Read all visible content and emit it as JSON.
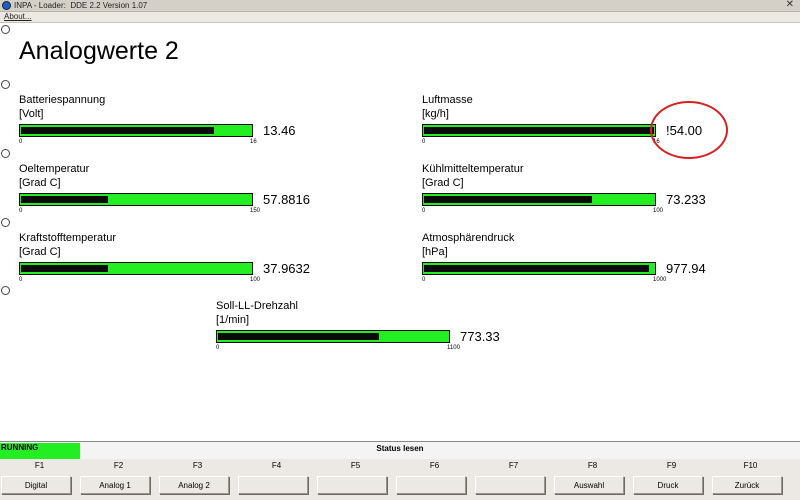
{
  "window": {
    "title": "INPA - Loader:  DDE 2.2 Version 1.07",
    "close_glyph": "✕",
    "app_icon": "inpa-app-icon"
  },
  "menu": {
    "about": "About..."
  },
  "page": {
    "title": "Analogwerte 2"
  },
  "gauges": [
    {
      "label": "Batteriespannung",
      "unit": "[Volt]",
      "min": "0",
      "max": "16",
      "value": "13.46",
      "fill": 0.84
    },
    {
      "label": "Luftmasse",
      "unit": "[kg/h]",
      "min": "0",
      "max": "16",
      "value": "!54.00",
      "fill": 1.0
    },
    {
      "label": "Oeltemperatur",
      "unit": "[Grad C]",
      "min": "0",
      "max": "150",
      "value": "57.8816",
      "fill": 0.38
    },
    {
      "label": "Kühlmitteltemperatur",
      "unit": "[Grad C]",
      "min": "0",
      "max": "100",
      "value": "73.233",
      "fill": 0.73
    },
    {
      "label": "Kraftstofftemperatur",
      "unit": "[Grad C]",
      "min": "0",
      "max": "100",
      "value": "37.9632",
      "fill": 0.38
    },
    {
      "label": "Atmosphärendruck",
      "unit": "[hPa]",
      "min": "0",
      "max": "1000",
      "value": "977.94",
      "fill": 0.98
    },
    {
      "label": "Soll-LL-Drehzahl",
      "unit": "[1/min]",
      "min": "0",
      "max": "1100",
      "value": "773.33",
      "fill": 0.7
    }
  ],
  "status": {
    "running": "RUNNING",
    "text": "Status lesen",
    "running_color": "#22ee22"
  },
  "fkeys": [
    {
      "key": "F1",
      "label": "Digital"
    },
    {
      "key": "F2",
      "label": "Analog 1"
    },
    {
      "key": "F3",
      "label": "Analog 2"
    },
    {
      "key": "F4",
      "label": ""
    },
    {
      "key": "F5",
      "label": ""
    },
    {
      "key": "F6",
      "label": ""
    },
    {
      "key": "F7",
      "label": ""
    },
    {
      "key": "F8",
      "label": "Auswahl"
    },
    {
      "key": "F9",
      "label": "Druck"
    },
    {
      "key": "F10",
      "label": "Zurück"
    }
  ],
  "colors": {
    "bar": "#22ee22",
    "fill": "#0a0a0a",
    "highlight": "#d82020"
  }
}
